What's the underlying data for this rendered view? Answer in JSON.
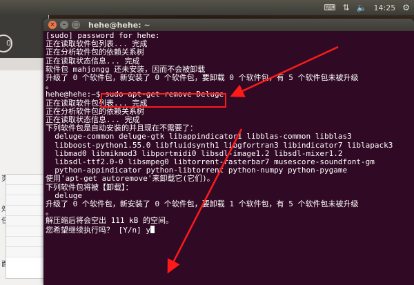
{
  "top_panel": {
    "keyboard_icon": "keyboard-icon",
    "network_icon": "network-icon",
    "volume_icon": "volume-icon",
    "time": "14:25",
    "power_icon": "power-icon"
  },
  "left_window": {
    "side_labels": [
      "页",
      "处",
      "任",
      "面"
    ]
  },
  "terminal": {
    "title": "hehe@hehe: ~",
    "lines": [
      "[sudo] password for hehe:",
      "正在读取软件包列表... 完成",
      "正在分析软件包的依赖关系树",
      "正在读取状态信息... 完成",
      "软件包 mahjongg 还未安装，因而不会被卸载",
      "升级了 0 个软件包，新安装了 0 个软件包，要卸载 0 个软件包，有 5 个软件包未被升级",
      "。",
      "hehe@hehe:~$ sudo apt-get remove Deluge",
      "正在读取软件包列表... 完成",
      "正在分析软件包的依赖关系树",
      "正在读取状态信息... 完成",
      "下列软件包是自动安装的并且现在不需要了：",
      "  deluge-common deluge-gtk libappindicator1 libblas-common libblas3",
      "  libboost-python1.55.0 libfluidsynth1 libgfortran3 libindicator7 liblapack3",
      "  libmad0 libmikmod3 libportmidi0 libsdl-image1.2 libsdl-mixer1.2",
      "  libsdl-ttf2.0-0 libsmpeg0 libtorrent-rasterbar7 musescore-soundfont-gm",
      "  python-appindicator python-libtorrent python-numpy python-pygame",
      "使用'apt-get autoremove'来卸载它(它们)。",
      "下列软件包将被【卸载】：",
      "  deluge",
      "升级了 0 个软件包，新安装了 0 个软件包，要卸载 1 个软件包，有 5 个软件包未被升级",
      "。",
      "解压缩后将会空出 111 kB 的空间。",
      "您希望继续执行吗？ [Y/n] y"
    ]
  }
}
